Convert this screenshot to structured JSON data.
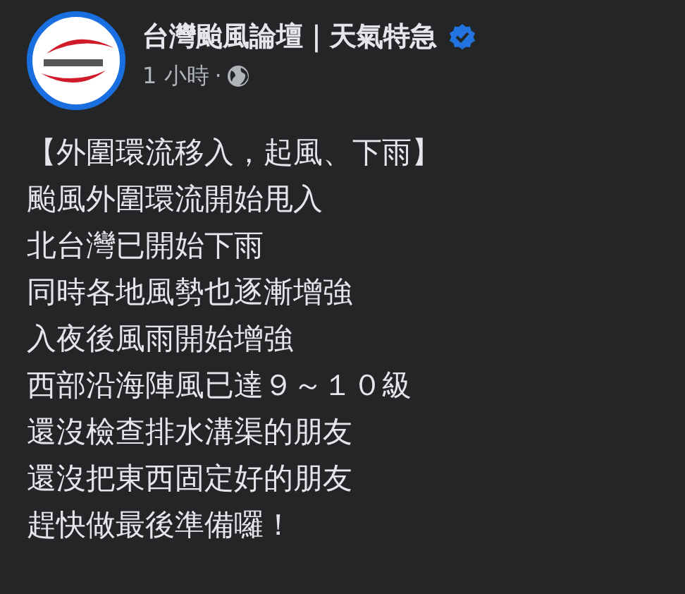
{
  "post": {
    "author": "台灣颱風論壇｜天氣特急",
    "verified": true,
    "time": "1 小時",
    "separator": "·",
    "lines": [
      "【外圍環流移入，起風、下雨】",
      "颱風外圍環流開始甩入",
      "北台灣已開始下雨",
      "同時各地風勢也逐漸增強",
      "入夜後風雨開始增強",
      "西部沿海陣風已達９～１０級",
      "還沒檢查排水溝渠的朋友",
      "還沒把東西固定好的朋友",
      "趕快做最後準備囉！"
    ]
  }
}
